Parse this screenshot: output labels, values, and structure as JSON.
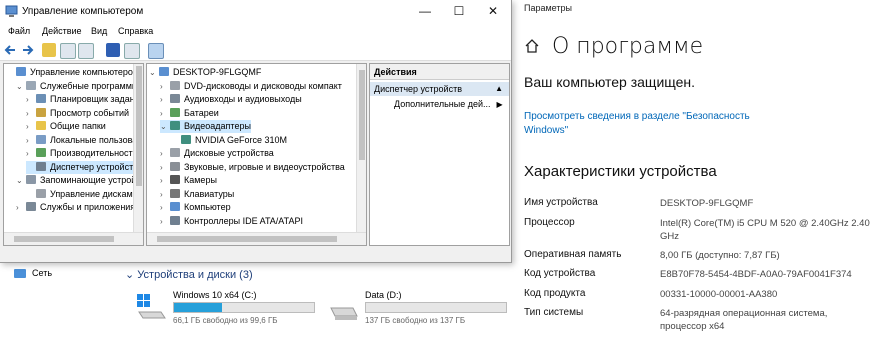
{
  "colors": {
    "accent": "#0067b8",
    "drive_fill": "#26a0da",
    "selection": "#cce8ff"
  },
  "mmc": {
    "title": "Управление компьютером",
    "controls": {
      "minimize": "—",
      "maximize": "☐",
      "close": "✕"
    },
    "menu": [
      "Файл",
      "Действие",
      "Вид",
      "Справка"
    ],
    "left_tree": [
      {
        "label": "Управление компьютером (л",
        "level": 0,
        "icon": "computer-management-icon",
        "chev": ""
      },
      {
        "label": "Служебные программы",
        "level": 1,
        "icon": "tools-icon",
        "chev": "v"
      },
      {
        "label": "Планировщик заданий",
        "level": 2,
        "icon": "clock-icon",
        "chev": ">"
      },
      {
        "label": "Просмотр событий",
        "level": 2,
        "icon": "event-viewer-icon",
        "chev": ">"
      },
      {
        "label": "Общие папки",
        "level": 2,
        "icon": "folder-icon",
        "chev": ">"
      },
      {
        "label": "Локальные пользовате",
        "level": 2,
        "icon": "users-icon",
        "chev": ">"
      },
      {
        "label": "Производительность",
        "level": 2,
        "icon": "performance-icon",
        "chev": ">"
      },
      {
        "label": "Диспетчер устройств",
        "level": 2,
        "icon": "device-manager-icon",
        "chev": "",
        "selected": true
      },
      {
        "label": "Запоминающие устройст",
        "level": 1,
        "icon": "storage-icon",
        "chev": "v"
      },
      {
        "label": "Управление дисками",
        "level": 2,
        "icon": "disk-icon",
        "chev": ""
      },
      {
        "label": "Службы и приложения",
        "level": 1,
        "icon": "services-icon",
        "chev": ">"
      }
    ],
    "device_tree": [
      {
        "label": "DESKTOP-9FLGQMF",
        "level": 0,
        "icon": "computer-icon",
        "chev": "v"
      },
      {
        "label": "DVD-дисководы и дисководы компакт",
        "level": 1,
        "icon": "dvd-icon",
        "chev": ">"
      },
      {
        "label": "Аудиовходы и аудиовыходы",
        "level": 1,
        "icon": "audio-icon",
        "chev": ">"
      },
      {
        "label": "Батареи",
        "level": 1,
        "icon": "battery-icon",
        "chev": ">"
      },
      {
        "label": "Видеоадаптеры",
        "level": 1,
        "icon": "display-adapter-icon",
        "chev": "v",
        "selected": true
      },
      {
        "label": "NVIDIA GeForce 310M",
        "level": 2,
        "icon": "display-adapter-icon",
        "chev": ""
      },
      {
        "label": "Дисковые устройства",
        "level": 1,
        "icon": "disk-drive-icon",
        "chev": ">"
      },
      {
        "label": "Звуковые, игровые и видеоустройства",
        "level": 1,
        "icon": "sound-icon",
        "chev": ">"
      },
      {
        "label": "Камеры",
        "level": 1,
        "icon": "camera-icon",
        "chev": ">"
      },
      {
        "label": "Клавиатуры",
        "level": 1,
        "icon": "keyboard-icon",
        "chev": ">"
      },
      {
        "label": "Компьютер",
        "level": 1,
        "icon": "computer-icon",
        "chev": ">"
      },
      {
        "label": "Контроллеры IDE ATA/ATAPI",
        "level": 1,
        "icon": "ide-controller-icon",
        "chev": ">"
      }
    ],
    "actions": {
      "header": "Действия",
      "section": "Диспетчер устройств",
      "more": "Дополнительные дей..."
    }
  },
  "explorer": {
    "network": "Сеть",
    "group_title": "Устройства и диски (3)",
    "drives": [
      {
        "name": "Windows 10 x64 (C:)",
        "free_text": "66,1 ГБ свободно из 99,6 ГБ",
        "used_fraction": 0.34
      },
      {
        "name": "Data (D:)",
        "free_text": "137 ГБ свободно из 137 ГБ",
        "used_fraction": 0.0
      }
    ]
  },
  "settings": {
    "window_title": "Параметры",
    "heading": "О программе",
    "protected": "Ваш компьютер защищен.",
    "security_link": "Просмотреть сведения в разделе \"Безопасность Windows\"",
    "specs_title": "Характеристики устройства",
    "specs": [
      {
        "key": "Имя устройства",
        "value": "DESKTOP-9FLGQMF"
      },
      {
        "key": "Процессор",
        "value": "Intel(R) Core(TM) i5 CPU       M 520  @ 2.40GHz   2.40 GHz"
      },
      {
        "key": "Оперативная память",
        "value": "8,00 ГБ (доступно: 7,87 ГБ)"
      },
      {
        "key": "Код устройства",
        "value": "E8B70F78-5454-4BDF-A0A0-79AF0041F374"
      },
      {
        "key": "Код продукта",
        "value": "00331-10000-00001-AA380"
      },
      {
        "key": "Тип системы",
        "value": "64-разрядная операционная система, процессор x64"
      }
    ]
  }
}
